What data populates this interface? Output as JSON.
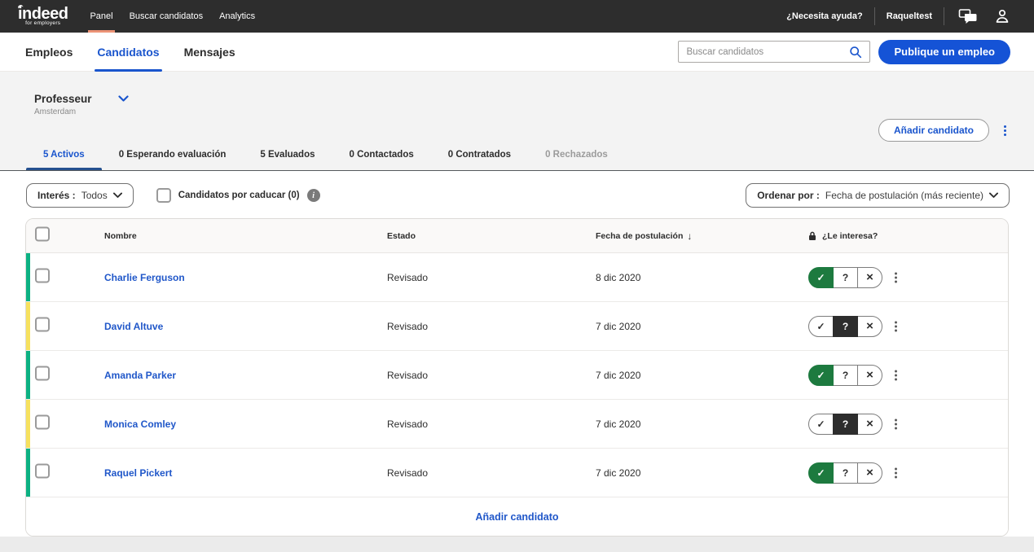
{
  "topbar": {
    "logo": {
      "brand": "indeed",
      "sub": "for employers"
    },
    "nav": [
      {
        "label": "Panel",
        "state": "active"
      },
      {
        "label": "Buscar candidatos",
        "state": "normal"
      },
      {
        "label": "Analytics",
        "state": "normal"
      }
    ],
    "help": "¿Necesita ayuda?",
    "account": "Raqueltest"
  },
  "subnav": {
    "tabs": [
      {
        "label": "Empleos",
        "state": "normal"
      },
      {
        "label": "Candidatos",
        "state": "active"
      },
      {
        "label": "Mensajes",
        "state": "normal"
      }
    ],
    "search_placeholder": "Buscar candidatos",
    "post_job_label": "Publique un empleo"
  },
  "job": {
    "title": "Professeur",
    "location": "Amsterdam",
    "add_candidate_label": "Añadir candidato"
  },
  "status_tabs": [
    {
      "label": "5 Activos",
      "state": "active"
    },
    {
      "label": "0 Esperando evaluación",
      "state": "normal"
    },
    {
      "label": "5 Evaluados",
      "state": "normal"
    },
    {
      "label": "0 Contactados",
      "state": "normal"
    },
    {
      "label": "0 Contratados",
      "state": "normal"
    },
    {
      "label": "0 Rechazados",
      "state": "disabled"
    }
  ],
  "filters": {
    "interest_label": "Interés :",
    "interest_value": "Todos",
    "expiring_label": "Candidatos por caducar (0)",
    "sort_label": "Ordenar por :",
    "sort_value": "Fecha de postulación (más reciente)"
  },
  "table": {
    "headers": {
      "name": "Nombre",
      "status": "Estado",
      "date": "Fecha de postulación",
      "sort_arrow": "↓",
      "interest": "¿Le interesa?"
    },
    "rows": [
      {
        "name": "Charlie Ferguson",
        "status": "Revisado",
        "date": "8 dic 2020",
        "interest": "yes",
        "bar": "green"
      },
      {
        "name": "David Altuve",
        "status": "Revisado",
        "date": "7 dic 2020",
        "interest": "maybe",
        "bar": "yellow"
      },
      {
        "name": "Amanda Parker",
        "status": "Revisado",
        "date": "7 dic 2020",
        "interest": "yes",
        "bar": "green"
      },
      {
        "name": "Monica Comley",
        "status": "Revisado",
        "date": "7 dic 2020",
        "interest": "maybe",
        "bar": "yellow"
      },
      {
        "name": "Raquel Pickert",
        "status": "Revisado",
        "date": "7 dic 2020",
        "interest": "yes",
        "bar": "green"
      }
    ],
    "footer_add_label": "Añadir candidato"
  },
  "glyphs": {
    "yes": "✓",
    "maybe": "?",
    "no": "×"
  },
  "icons": {
    "search": "magnifier",
    "chat": "speech-bubbles",
    "account": "person-silhouette",
    "chevron_down": "⌄",
    "sort_desc": "↓",
    "lock": "padlock",
    "info_letter": "i",
    "kebab": "vertical-three-dots"
  },
  "colors": {
    "navbar_bg": "#2d2d2d",
    "accent_blue": "#1a55cd",
    "post_button_blue": "#1553d6",
    "panel_underline_orange": "#ec9376",
    "active_tab_underline": "#24508f",
    "interest_yes_green": "#1d7a3f",
    "interest_maybe_dark": "#2d2d2d",
    "row_bar_green": "#0cb183",
    "row_bar_yellow": "#f6e15e"
  }
}
